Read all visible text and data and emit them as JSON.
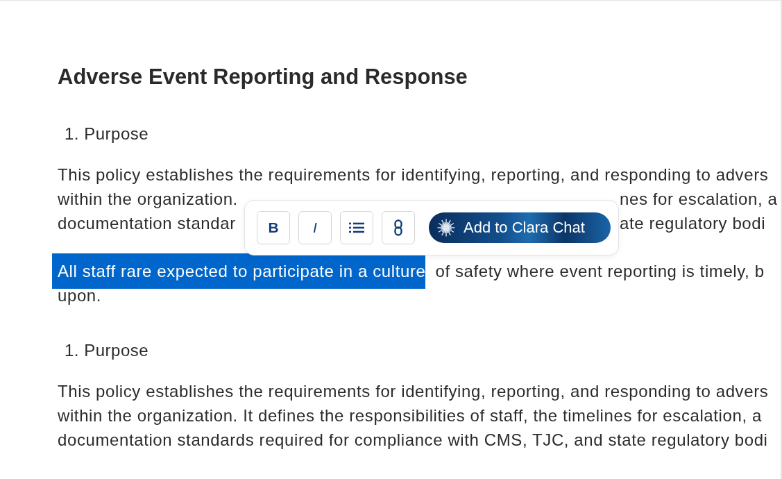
{
  "document": {
    "title": "Adverse Event Reporting and Response",
    "blocks": [
      {
        "kind": "heading",
        "number": "1.",
        "text": "Purpose"
      },
      {
        "kind": "paragraph",
        "lines": [
          {
            "parts": [
              {
                "text": "This policy establishes the requirements for identifying, reporting, and responding to advers",
                "selected": false
              }
            ]
          },
          {
            "parts": [
              {
                "text": "within the organization.",
                "selected": false
              },
              {
                "text": "nes for escalation, a",
                "selected": false
              }
            ]
          },
          {
            "parts": [
              {
                "text": "documentation standar",
                "selected": false
              },
              {
                "text": "ate regulatory bodi",
                "selected": false
              }
            ]
          }
        ]
      },
      {
        "kind": "paragraph",
        "lines": [
          {
            "parts": [
              {
                "text": "All staff rare expected to participate in a culture",
                "selected": true
              },
              {
                "text": "of safety where event reporting is timely, b",
                "selected": false
              }
            ]
          },
          {
            "parts": [
              {
                "text": "upon.",
                "selected": false
              }
            ]
          }
        ]
      },
      {
        "kind": "heading",
        "number": "1.",
        "text": "Purpose"
      },
      {
        "kind": "paragraph",
        "lines": [
          {
            "parts": [
              {
                "text": "This policy establishes the requirements for identifying, reporting, and responding to advers",
                "selected": false
              }
            ]
          },
          {
            "parts": [
              {
                "text": "within the organization. It defines the responsibilities of staff, the timelines for escalation, a",
                "selected": false
              }
            ]
          },
          {
            "parts": [
              {
                "text": "documentation standards required for compliance with CMS, TJC, and state regulatory bodi",
                "selected": false
              }
            ]
          }
        ]
      }
    ]
  },
  "toolbar": {
    "buttons": [
      {
        "kind": "bold",
        "label": "B"
      },
      {
        "kind": "italic",
        "label": "I"
      },
      {
        "kind": "list"
      },
      {
        "kind": "link"
      }
    ],
    "chat_button": "Add to Clara Chat"
  }
}
